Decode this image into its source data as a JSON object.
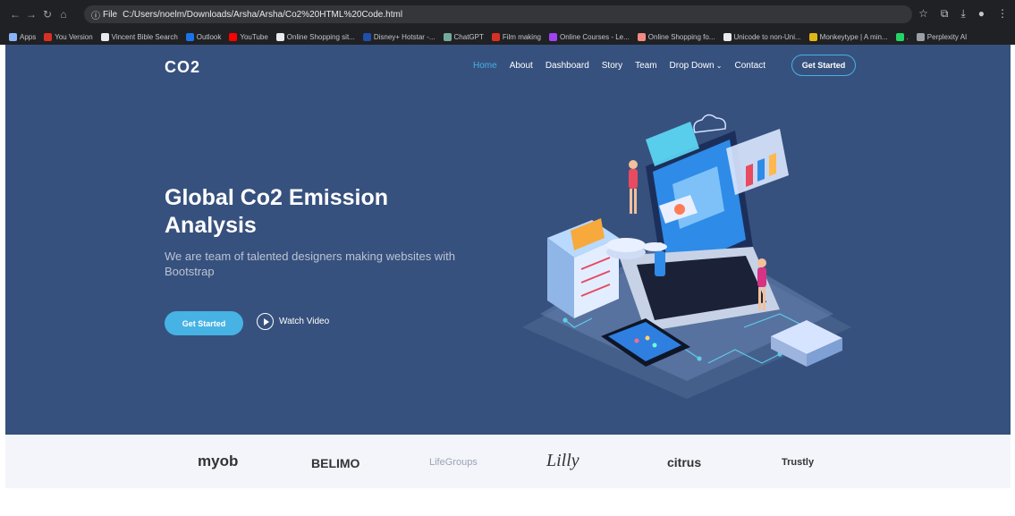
{
  "browser": {
    "file_chip": "File",
    "url": "C:/Users/noelm/Downloads/Arsha/Arsha/Co2%20HTML%20Code.html",
    "bookmarks": [
      {
        "label": "Apps",
        "color": "#8ab4f8"
      },
      {
        "label": "You Version",
        "color": "#d93025"
      },
      {
        "label": "Vincent Bible Search",
        "color": "#e8eaed"
      },
      {
        "label": "Outlook",
        "color": "#1a73e8"
      },
      {
        "label": "YouTube",
        "color": "#ff0000"
      },
      {
        "label": "Online Shopping sit...",
        "color": "#e8eaed"
      },
      {
        "label": "Disney+ Hotstar -...",
        "color": "#1f4fa8"
      },
      {
        "label": "ChatGPT",
        "color": "#74aa9c"
      },
      {
        "label": "Film making",
        "color": "#d93025"
      },
      {
        "label": "Online Courses - Le...",
        "color": "#a142f4"
      },
      {
        "label": "Online Shopping fo...",
        "color": "#f28b82"
      },
      {
        "label": "Unicode to non-Uni...",
        "color": "#e8eaed"
      },
      {
        "label": "Monkeytype | A min...",
        "color": "#e2b714"
      },
      {
        "label": ".",
        "color": "#25d366"
      },
      {
        "label": "Perplexity AI",
        "color": "#9aa0a6"
      }
    ]
  },
  "nav": {
    "logo": "CO2",
    "items": [
      "Home",
      "About",
      "Dashboard",
      "Story",
      "Team",
      "Drop Down",
      "Contact"
    ],
    "active": "Home",
    "cta": "Get Started"
  },
  "hero": {
    "title": "Global Co2 Emission Analysis",
    "subtitle": "We are team of talented designers making websites with Bootstrap",
    "cta": "Get Started",
    "watch": "Watch Video"
  },
  "clients": [
    "myob",
    "BELIMO",
    "LifeGroups",
    "Lilly",
    "citrus",
    "Trustly"
  ],
  "colors": {
    "hero_bg": "#37517e",
    "accent": "#47b2e4",
    "clients_bg": "#f3f5fa"
  }
}
